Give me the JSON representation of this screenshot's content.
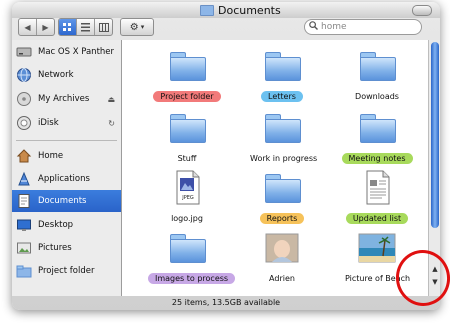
{
  "window": {
    "title": "Documents"
  },
  "toolbar": {
    "back_glyph": "◀",
    "forward_glyph": "▶",
    "view_icons": [
      "icon-view-icon",
      "list-view-icon",
      "column-view-icon"
    ],
    "action_glyph": "⚙",
    "action_caret": "▾",
    "search": {
      "placeholder": "home",
      "value": "home"
    }
  },
  "sidebar": {
    "devices": [
      {
        "label": "Mac OS X Panther",
        "icon": "hard-disk-icon"
      },
      {
        "label": "Network",
        "icon": "network-globe-icon"
      },
      {
        "label": "My Archives",
        "icon": "disk-icon",
        "trail": "⏏"
      },
      {
        "label": "iDisk",
        "icon": "idisk-icon",
        "trail": "↻"
      }
    ],
    "places": [
      {
        "label": "Home",
        "icon": "home-icon"
      },
      {
        "label": "Applications",
        "icon": "applications-icon"
      },
      {
        "label": "Documents",
        "icon": "documents-icon",
        "selected": true
      },
      {
        "label": "Desktop",
        "icon": "desktop-icon"
      },
      {
        "label": "Pictures",
        "icon": "pictures-icon"
      },
      {
        "label": "Project folder",
        "icon": "project-folder-icon"
      }
    ]
  },
  "items": [
    {
      "name": "Project folder",
      "type": "folder",
      "label_color": "#f27a7a"
    },
    {
      "name": "Letters",
      "type": "folder",
      "label_color": "#6cc1f0"
    },
    {
      "name": "Downloads",
      "type": "folder",
      "label_color": ""
    },
    {
      "name": "Stuff",
      "type": "folder",
      "label_color": ""
    },
    {
      "name": "Work in progress",
      "type": "folder",
      "label_color": ""
    },
    {
      "name": "Meeting notes",
      "type": "folder",
      "label_color": "#a8da5c"
    },
    {
      "name": "logo.jpg",
      "type": "jpeg",
      "label_color": "",
      "badge": "JPEG"
    },
    {
      "name": "Reports",
      "type": "folder",
      "label_color": "#f6c25a"
    },
    {
      "name": "Updated list",
      "type": "document",
      "label_color": "#a8da5c"
    },
    {
      "name": "Images to process",
      "type": "folder",
      "label_color": "#c7a8e6"
    },
    {
      "name": "Adrien",
      "type": "photo-baby",
      "label_color": ""
    },
    {
      "name": "Picture of Beach",
      "type": "photo-beach",
      "label_color": ""
    }
  ],
  "status": {
    "text": "25 items, 13.5GB available"
  },
  "scrollbar": {
    "up_glyph": "▲",
    "down_glyph": "▼",
    "thumb_fraction": 0.75
  },
  "annotation": {
    "color": "#e01010"
  }
}
